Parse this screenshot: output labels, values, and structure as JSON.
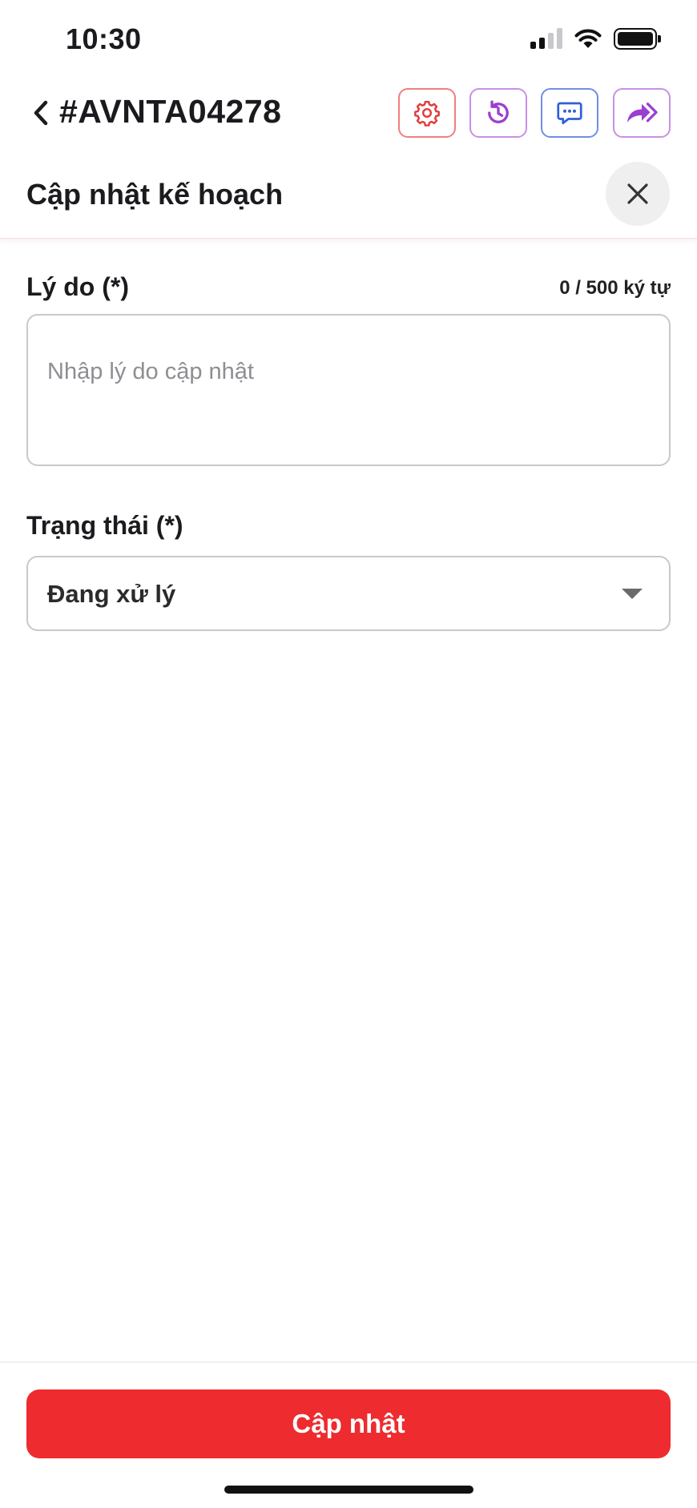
{
  "status_bar": {
    "time": "10:30",
    "icons": [
      "signal-icon",
      "wifi-icon",
      "battery-icon"
    ]
  },
  "nav": {
    "ticket_id": "#AVNTA04278",
    "back_icon": "chevron-left-icon",
    "actions": [
      {
        "name": "settings",
        "icon": "gear-icon",
        "color": "#e23a3a"
      },
      {
        "name": "history",
        "icon": "history-icon",
        "color": "#9b3fd0"
      },
      {
        "name": "chat",
        "icon": "chat-icon",
        "color": "#2f5fd8"
      },
      {
        "name": "forward",
        "icon": "forward-icon",
        "color": "#9b3fd0"
      }
    ]
  },
  "sheet": {
    "title": "Cập nhật kế hoạch",
    "close_icon": "close-icon"
  },
  "form": {
    "reason_label": "Lý do (*)",
    "reason_counter": "0 / 500 ký tự",
    "reason_placeholder": "Nhập lý do cập nhật",
    "reason_value": "",
    "status_label": "Trạng thái (*)",
    "status_value": "Đang xử lý"
  },
  "submit": {
    "label": "Cập nhật",
    "color": "#ee2b2e"
  }
}
